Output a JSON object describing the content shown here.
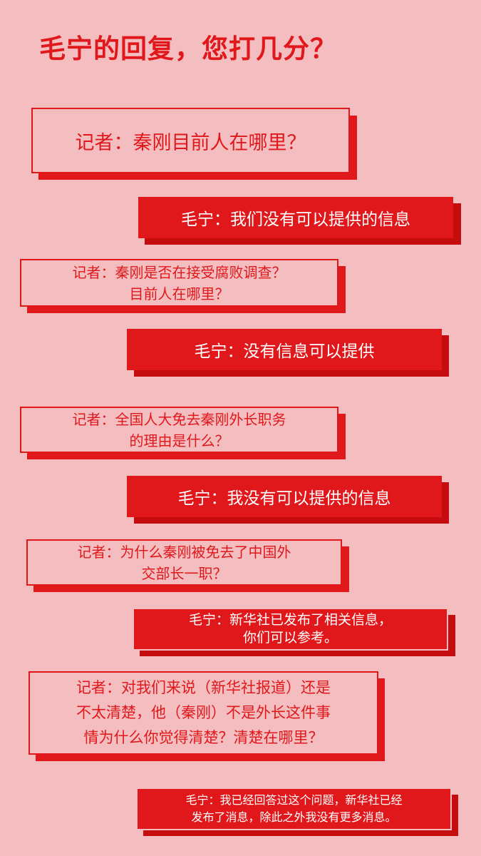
{
  "title": "毛宁的回复，您打几分？",
  "dialogue": [
    {
      "speaker": "reporter",
      "lines": [
        "记者：秦刚目前人在哪里？"
      ]
    },
    {
      "speaker": "spokesperson",
      "lines": [
        "毛宁：我们没有可以提供的信息"
      ]
    },
    {
      "speaker": "reporter",
      "lines": [
        "记者：秦刚是否在接受腐败调查？",
        "目前人在哪里？"
      ]
    },
    {
      "speaker": "spokesperson",
      "lines": [
        "毛宁：没有信息可以提供"
      ]
    },
    {
      "speaker": "reporter",
      "lines": [
        "记者：全国人大免去秦刚外长职务",
        "的理由是什么？"
      ]
    },
    {
      "speaker": "spokesperson",
      "lines": [
        "毛宁：我没有可以提供的信息"
      ]
    },
    {
      "speaker": "reporter",
      "lines": [
        "记者：为什么秦刚被免去了中国外",
        "交部长一职？"
      ]
    },
    {
      "speaker": "spokesperson",
      "lines": [
        "毛宁：新华社已发布了相关信息，",
        "你们可以参考。"
      ]
    },
    {
      "speaker": "reporter",
      "lines": [
        "记者：对我们来说（新华社报道）还是",
        "不太清楚，他（秦刚）不是外长这件事",
        "情为什么你觉得清楚？清楚在哪里？"
      ]
    },
    {
      "speaker": "spokesperson",
      "lines": [
        "毛宁：我已经回答过这个问题，新华社已经",
        "发布了消息，除此之外我没有更多消息。"
      ]
    }
  ],
  "colors": {
    "background": "#f4bec0",
    "accent": "#e0181b",
    "text_on_accent": "#ffffff"
  }
}
